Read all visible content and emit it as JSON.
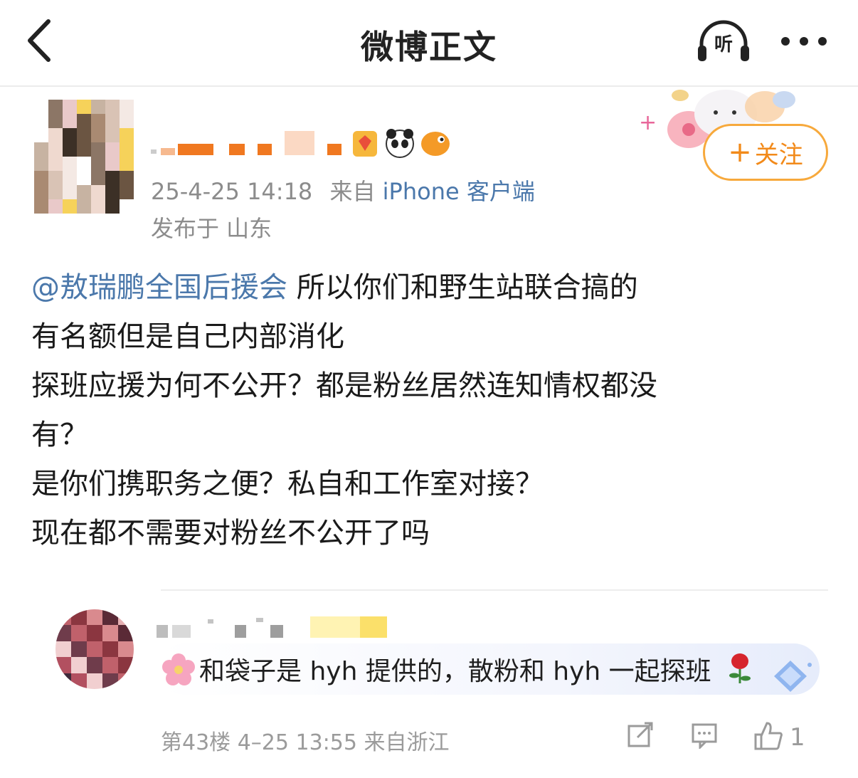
{
  "header": {
    "title": "微博正文",
    "listen_label": "听"
  },
  "post": {
    "timestamp": "25-4-25 14:18",
    "source_prefix": "来自",
    "source": "iPhone 客户端",
    "location": "发布于 山东",
    "follow_label": "关注",
    "mention": "@敖瑞鹏全国后援会",
    "lines": [
      " 所以你们和野生站联合搞的",
      "有名额但是自己内部消化",
      "探班应援为何不公开？都是粉丝居然连知情权都没",
      "有？",
      "是你们携职务之便？私自和工作室对接？",
      "现在都不需要对粉丝不公开了吗"
    ]
  },
  "comment": {
    "text": "和袋子是 hyh 提供的，散粉和 hyh 一起探班",
    "floor_meta": "第43楼 4–25 13:55 来自浙江",
    "like_count": "1"
  },
  "icons": {
    "back": "chevron-left-icon",
    "listen": "headphones-icon",
    "more": "more-dots-icon",
    "share": "share-edit-icon",
    "reply": "comment-icon",
    "like": "thumbs-up-icon"
  },
  "colors": {
    "link": "#4b78ab",
    "follow": "#f28a1a",
    "meta": "#8c8c8c"
  }
}
